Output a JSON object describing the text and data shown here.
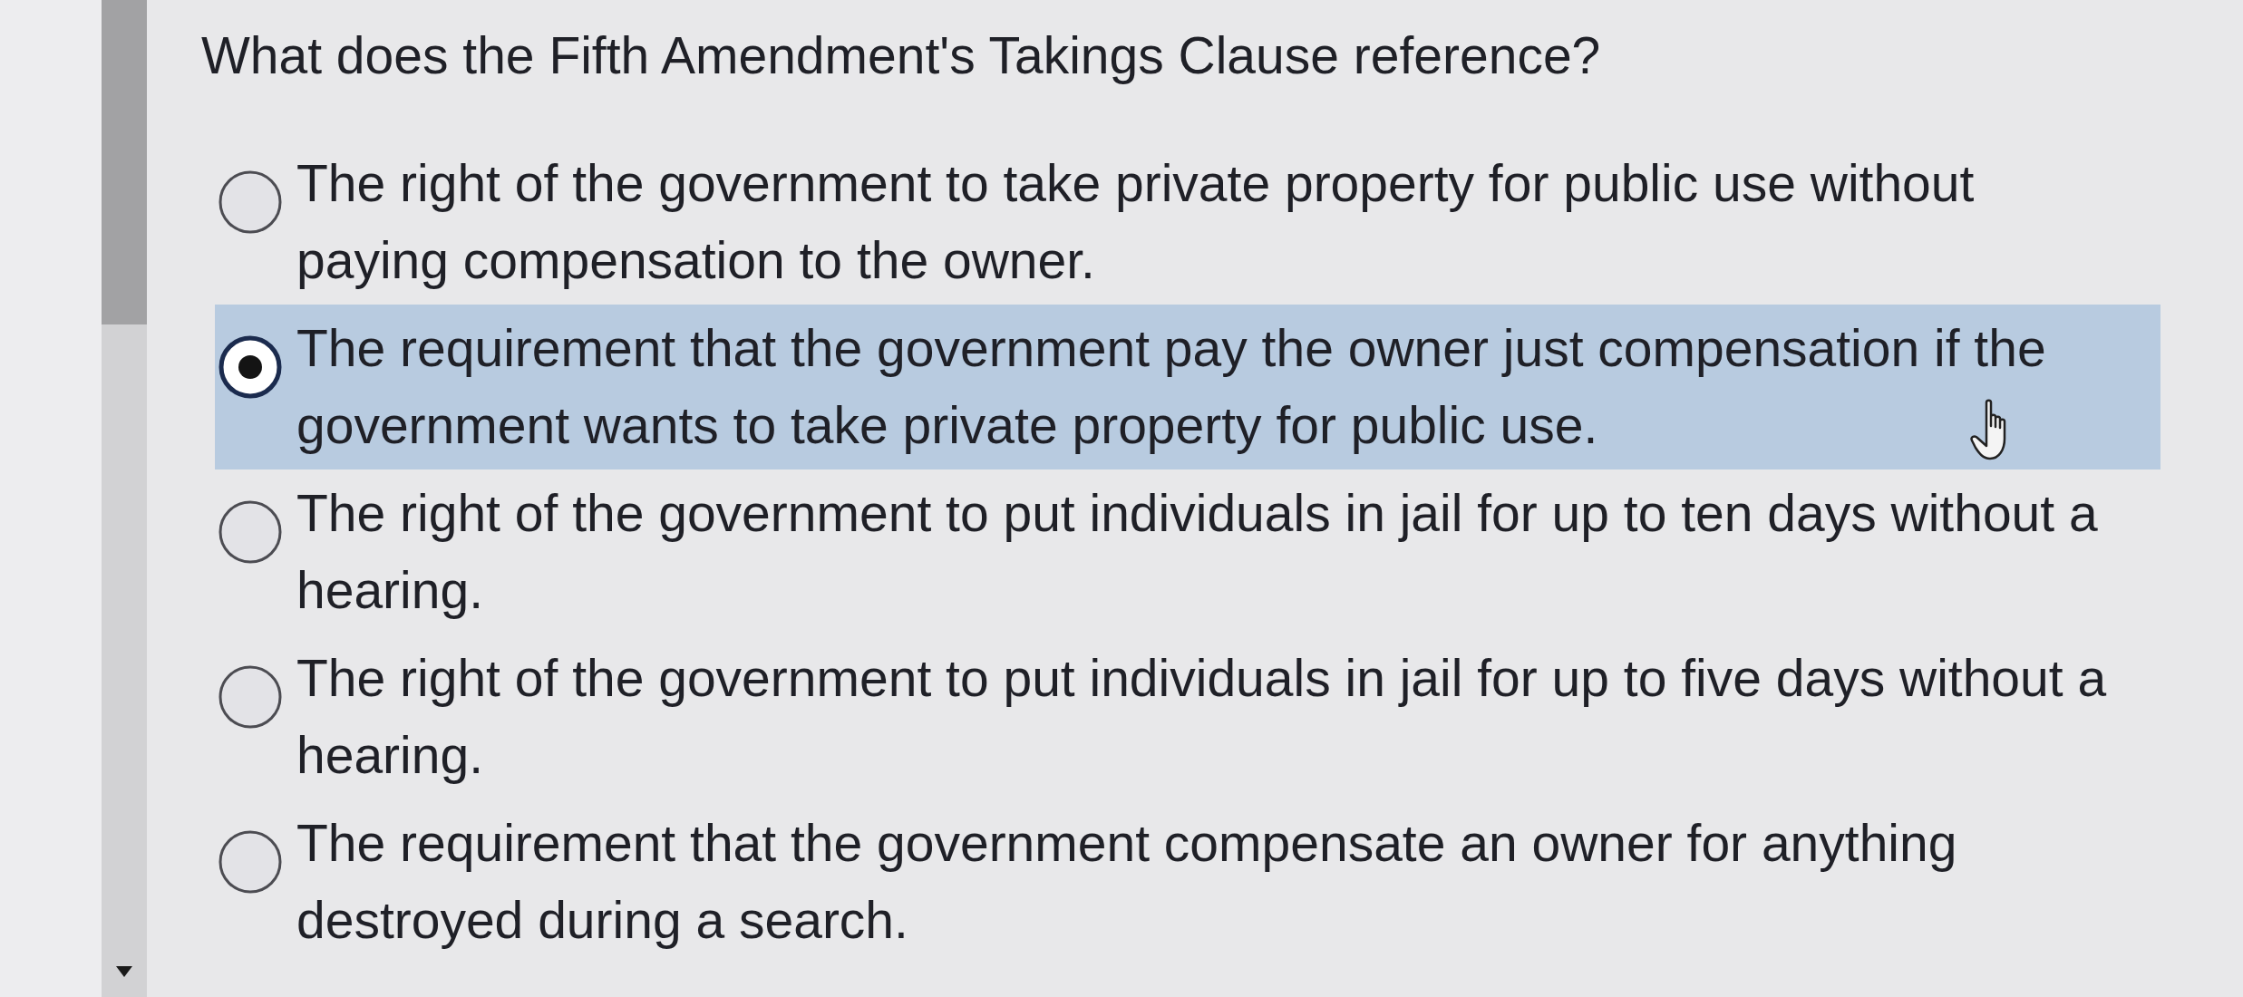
{
  "question": "What does the Fifth Amendment's Takings Clause reference?",
  "options": [
    {
      "text": "The right of the government to take private property for public use without paying compensation to the owner.",
      "selected": false
    },
    {
      "text": "The requirement that the government pay the owner just compensation if the government wants to take private property for public use.",
      "selected": true
    },
    {
      "text": "The right of the government to put individuals in jail for up to ten days without a hearing.",
      "selected": false
    },
    {
      "text": "The right of the government to put individuals in jail for up to five days without a hearing.",
      "selected": false
    },
    {
      "text": "The requirement that the government compensate an owner for anything destroyed during a search.",
      "selected": false
    }
  ]
}
